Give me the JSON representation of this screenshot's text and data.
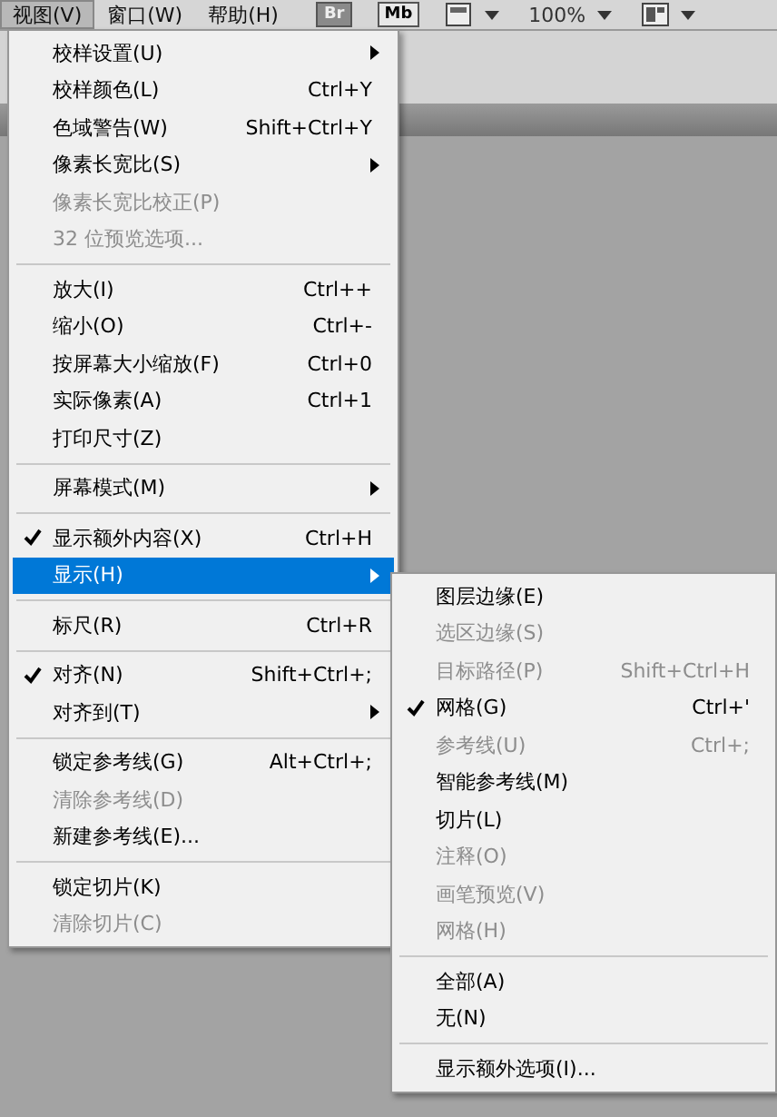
{
  "menubar": [
    {
      "label": "视图(V)",
      "selected": true
    },
    {
      "label": "窗口(W)",
      "selected": false
    },
    {
      "label": "帮助(H)",
      "selected": false
    }
  ],
  "toolbar": {
    "bridge": "Br",
    "mini_bridge": "Mb",
    "zoom": "100%"
  },
  "menu": [
    {
      "kind": "item",
      "label": "校样设置(U)",
      "submenu": true,
      "checked": false,
      "disabled": false,
      "selected": false
    },
    {
      "kind": "item",
      "label": "校样颜色(L)",
      "shortcut": "Ctrl+Y",
      "checked": false,
      "disabled": false,
      "selected": false
    },
    {
      "kind": "item",
      "label": "色域警告(W)",
      "shortcut": "Shift+Ctrl+Y",
      "checked": false,
      "disabled": false,
      "selected": false
    },
    {
      "kind": "item",
      "label": "像素长宽比(S)",
      "submenu": true,
      "checked": false,
      "disabled": false,
      "selected": false
    },
    {
      "kind": "item",
      "label": "像素长宽比校正(P)",
      "checked": false,
      "disabled": true,
      "selected": false
    },
    {
      "kind": "item",
      "label": "32 位预览选项...",
      "checked": false,
      "disabled": true,
      "selected": false
    },
    {
      "kind": "separator"
    },
    {
      "kind": "item",
      "label": "放大(I)",
      "shortcut": "Ctrl++",
      "checked": false,
      "disabled": false,
      "selected": false
    },
    {
      "kind": "item",
      "label": "缩小(O)",
      "shortcut": "Ctrl+-",
      "checked": false,
      "disabled": false,
      "selected": false
    },
    {
      "kind": "item",
      "label": "按屏幕大小缩放(F)",
      "shortcut": "Ctrl+0",
      "checked": false,
      "disabled": false,
      "selected": false
    },
    {
      "kind": "item",
      "label": "实际像素(A)",
      "shortcut": "Ctrl+1",
      "checked": false,
      "disabled": false,
      "selected": false
    },
    {
      "kind": "item",
      "label": "打印尺寸(Z)",
      "checked": false,
      "disabled": false,
      "selected": false
    },
    {
      "kind": "separator"
    },
    {
      "kind": "item",
      "label": "屏幕模式(M)",
      "submenu": true,
      "checked": false,
      "disabled": false,
      "selected": false
    },
    {
      "kind": "separator"
    },
    {
      "kind": "item",
      "label": "显示额外内容(X)",
      "shortcut": "Ctrl+H",
      "checked": true,
      "disabled": false,
      "selected": false
    },
    {
      "kind": "item",
      "label": "显示(H)",
      "submenu": true,
      "checked": false,
      "disabled": false,
      "selected": true
    },
    {
      "kind": "separator"
    },
    {
      "kind": "item",
      "label": "标尺(R)",
      "shortcut": "Ctrl+R",
      "checked": false,
      "disabled": false,
      "selected": false
    },
    {
      "kind": "separator"
    },
    {
      "kind": "item",
      "label": "对齐(N)",
      "shortcut": "Shift+Ctrl+;",
      "checked": true,
      "disabled": false,
      "selected": false
    },
    {
      "kind": "item",
      "label": "对齐到(T)",
      "submenu": true,
      "checked": false,
      "disabled": false,
      "selected": false
    },
    {
      "kind": "separator"
    },
    {
      "kind": "item",
      "label": "锁定参考线(G)",
      "shortcut": "Alt+Ctrl+;",
      "checked": false,
      "disabled": false,
      "selected": false
    },
    {
      "kind": "item",
      "label": "清除参考线(D)",
      "checked": false,
      "disabled": true,
      "selected": false
    },
    {
      "kind": "item",
      "label": "新建参考线(E)...",
      "checked": false,
      "disabled": false,
      "selected": false
    },
    {
      "kind": "separator"
    },
    {
      "kind": "item",
      "label": "锁定切片(K)",
      "checked": false,
      "disabled": false,
      "selected": false
    },
    {
      "kind": "item",
      "label": "清除切片(C)",
      "checked": false,
      "disabled": true,
      "selected": false
    }
  ],
  "submenu": [
    {
      "kind": "item",
      "label": "图层边缘(E)",
      "checked": false,
      "disabled": false
    },
    {
      "kind": "item",
      "label": "选区边缘(S)",
      "checked": false,
      "disabled": true
    },
    {
      "kind": "item",
      "label": "目标路径(P)",
      "shortcut": "Shift+Ctrl+H",
      "checked": false,
      "disabled": true
    },
    {
      "kind": "item",
      "label": "网格(G)",
      "shortcut": "Ctrl+'",
      "checked": true,
      "disabled": false
    },
    {
      "kind": "item",
      "label": "参考线(U)",
      "shortcut": "Ctrl+;",
      "checked": false,
      "disabled": true
    },
    {
      "kind": "item",
      "label": "智能参考线(M)",
      "checked": false,
      "disabled": false
    },
    {
      "kind": "item",
      "label": "切片(L)",
      "checked": false,
      "disabled": false
    },
    {
      "kind": "item",
      "label": "注释(O)",
      "checked": false,
      "disabled": true
    },
    {
      "kind": "item",
      "label": "画笔预览(V)",
      "checked": false,
      "disabled": true
    },
    {
      "kind": "item",
      "label": "网格(H)",
      "checked": false,
      "disabled": true
    },
    {
      "kind": "separator"
    },
    {
      "kind": "item",
      "label": "全部(A)",
      "checked": false,
      "disabled": false
    },
    {
      "kind": "item",
      "label": "无(N)",
      "checked": false,
      "disabled": false
    },
    {
      "kind": "separator"
    },
    {
      "kind": "item",
      "label": "显示额外选项(I)...",
      "checked": false,
      "disabled": false
    }
  ]
}
